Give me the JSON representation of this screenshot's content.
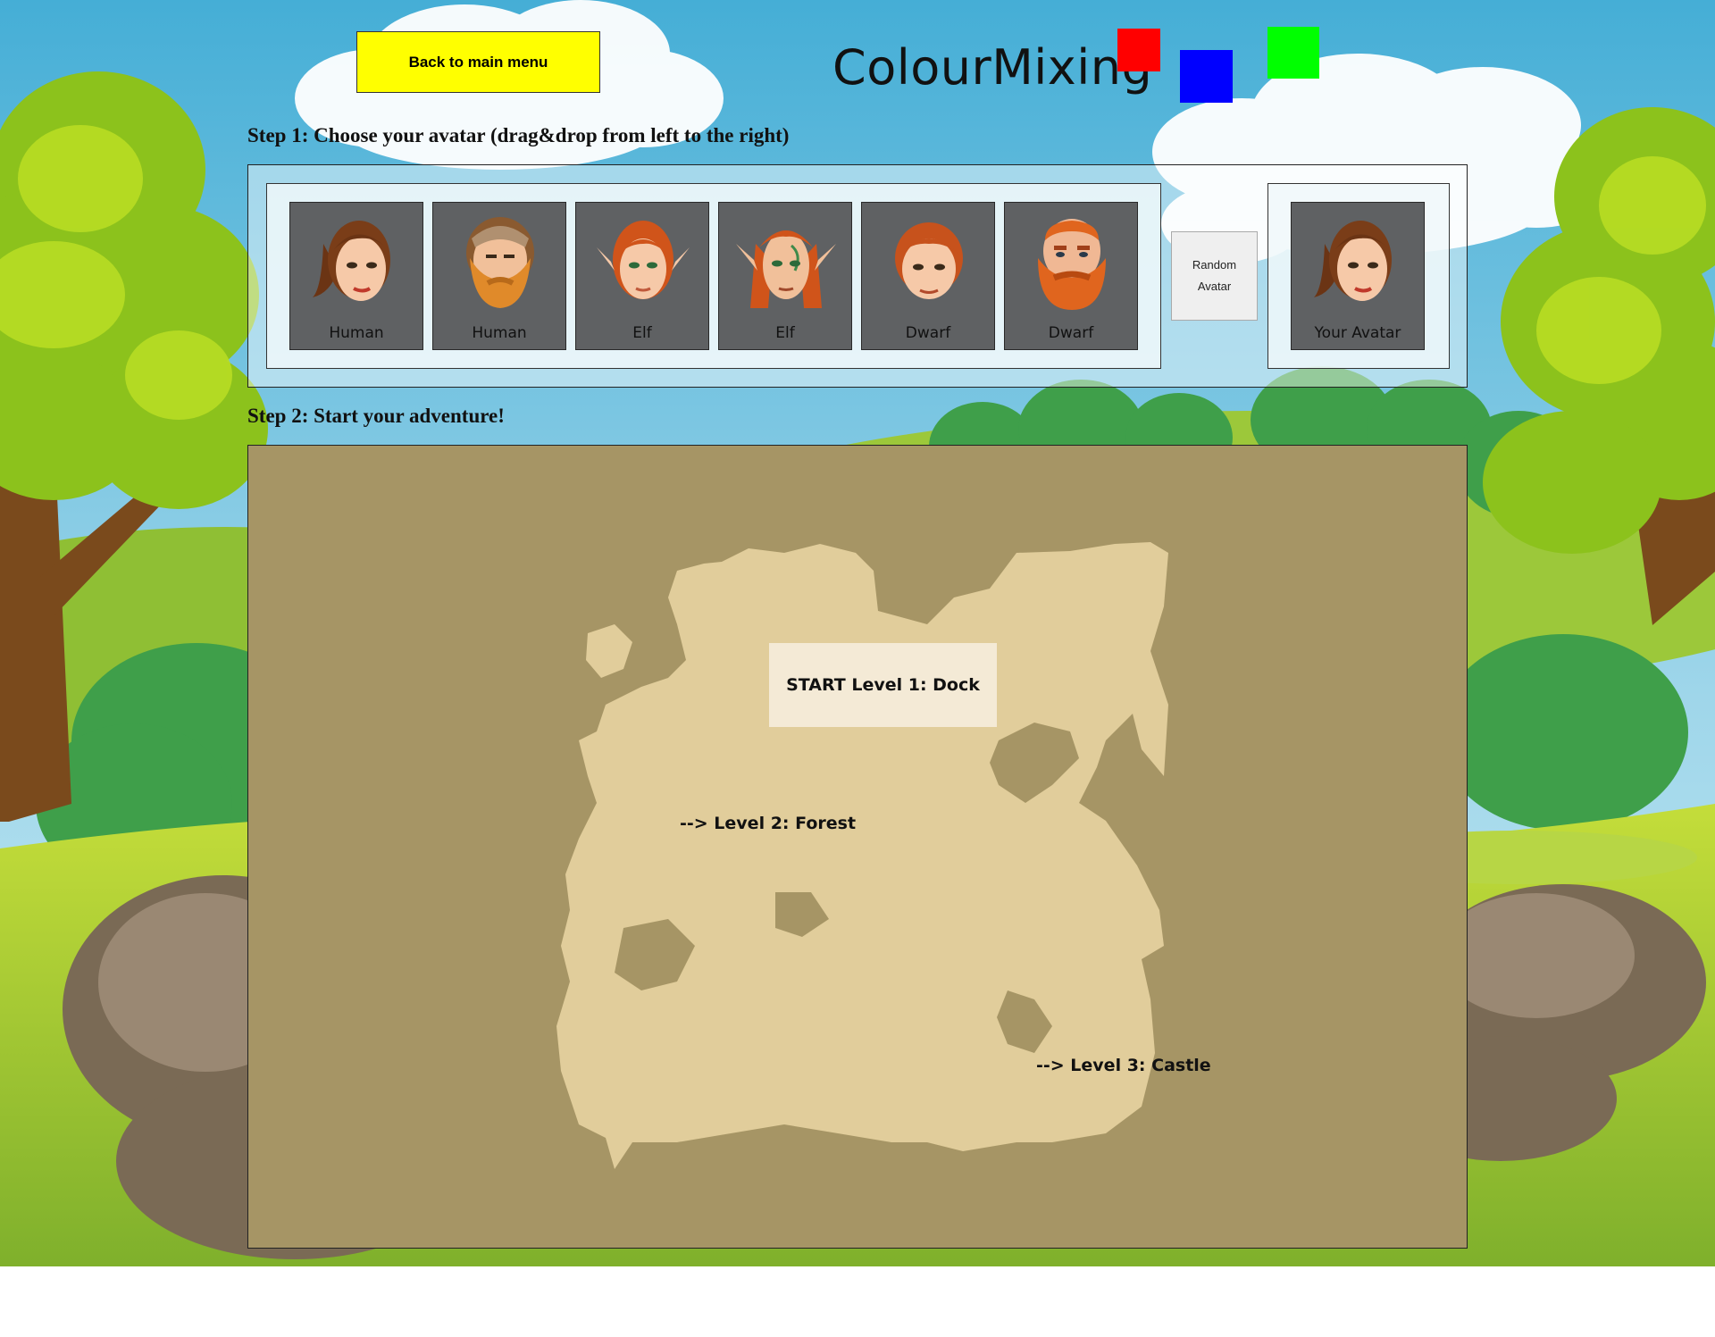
{
  "header": {
    "back_button": "Back to main menu",
    "title": "ColourMixing",
    "squares": [
      "#ff0000",
      "#0000ff",
      "#00ff00"
    ]
  },
  "step1": {
    "heading": "Step 1: Choose your avatar (drag&drop from left to the right)",
    "avatars": [
      {
        "label": "Human",
        "icon": "human-female-icon"
      },
      {
        "label": "Human",
        "icon": "human-male-bearded-icon"
      },
      {
        "label": "Elf",
        "icon": "elf-female-icon"
      },
      {
        "label": "Elf",
        "icon": "elf-male-icon"
      },
      {
        "label": "Dwarf",
        "icon": "dwarf-female-icon"
      },
      {
        "label": "Dwarf",
        "icon": "dwarf-male-icon"
      }
    ],
    "random_button": [
      "Random",
      "Avatar"
    ],
    "selected": {
      "label": "Your Avatar",
      "icon": "human-female-icon"
    }
  },
  "step2": {
    "heading": "Step 2: Start your adventure!",
    "levels": [
      "START Level 1: Dock",
      "--> Level 2: Forest",
      "--> Level 3: Castle"
    ]
  },
  "colors": {
    "map_sea": "#a69565",
    "map_land": "#e1cd9b",
    "level1_bg": "#f4ead6",
    "back_button": "#ffff00"
  }
}
